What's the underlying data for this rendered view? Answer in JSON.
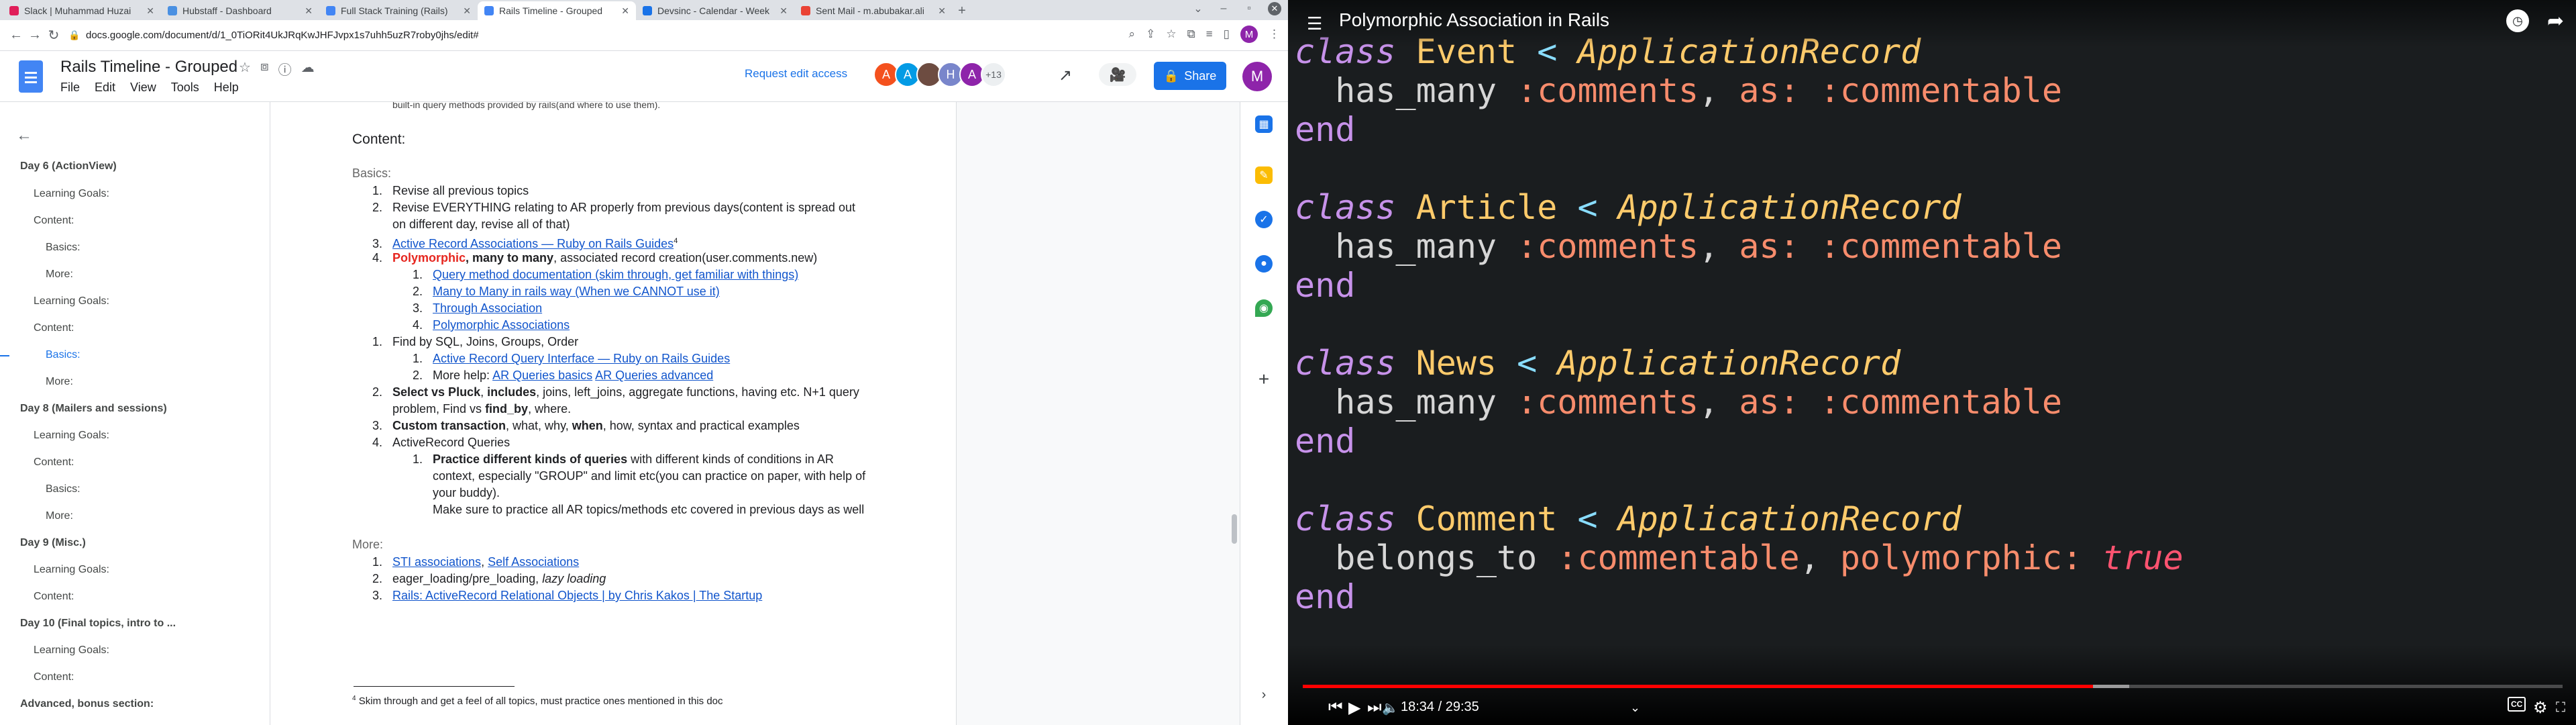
{
  "browser": {
    "tabs": [
      {
        "label": "Slack | Muhammad Huzai",
        "color": "#e01e5a",
        "active": false
      },
      {
        "label": "Hubstaff - Dashboard",
        "color": "#4a90e2",
        "active": false
      },
      {
        "label": "Full Stack Training (Rails)",
        "color": "#4285f4",
        "active": false
      },
      {
        "label": "Rails Timeline - Grouped",
        "color": "#4285f4",
        "active": true
      },
      {
        "label": "Devsinc - Calendar - Week",
        "color": "#1a73e8",
        "active": false
      },
      {
        "label": "Sent Mail - m.abubakar.ali",
        "color": "#ea4335",
        "active": false
      }
    ],
    "new_tab": "+",
    "url": "docs.google.com/document/d/1_0TiORit4UkJRqKwJHFJvpx1s7uhh5uzR7roby0jhs/edit#",
    "profile_initial": "M"
  },
  "docs": {
    "title": "Rails Timeline - Grouped",
    "menus": [
      "File",
      "Edit",
      "View",
      "Tools",
      "Help"
    ],
    "request_access": "Request edit access",
    "collaborators": [
      {
        "initial": "A",
        "color": "#f4511e"
      },
      {
        "initial": "A",
        "color": "#039be5"
      },
      {
        "initial": "",
        "color": "#6d4c41"
      },
      {
        "initial": "H",
        "color": "#7986cb"
      },
      {
        "initial": "A",
        "color": "#8e24aa"
      }
    ],
    "collaborators_more": "+13",
    "share_label": "Share",
    "me_initial": "M"
  },
  "outline": [
    {
      "label": "Day 6 (ActionView)",
      "level": 1
    },
    {
      "label": "Learning Goals:",
      "level": 2
    },
    {
      "label": "Content:",
      "level": 2
    },
    {
      "label": "Basics:",
      "level": 3
    },
    {
      "label": "More:",
      "level": 3
    },
    {
      "label": "Learning Goals:",
      "level": 2
    },
    {
      "label": "Content:",
      "level": 2
    },
    {
      "label": "Basics:",
      "level": 3,
      "selected": true
    },
    {
      "label": "More:",
      "level": 3
    },
    {
      "label": "Day 8 (Mailers and sessions)",
      "level": 1
    },
    {
      "label": "Learning Goals:",
      "level": 2
    },
    {
      "label": "Content:",
      "level": 2
    },
    {
      "label": "Basics:",
      "level": 3
    },
    {
      "label": "More:",
      "level": 3
    },
    {
      "label": "Day 9 (Misc.)",
      "level": 1
    },
    {
      "label": "Learning Goals:",
      "level": 2
    },
    {
      "label": "Content:",
      "level": 2
    },
    {
      "label": "Day 10 (Final topics, intro to ...",
      "level": 1
    },
    {
      "label": "Learning Goals:",
      "level": 2
    },
    {
      "label": "Content:",
      "level": 2
    },
    {
      "label": "Advanced, bonus section:",
      "level": 1
    }
  ],
  "doc": {
    "cut_line": "built-in query methods provided by rails(and where to use them).",
    "content_heading": "Content:",
    "basics_heading": "Basics:",
    "b1": "Revise all previous topics",
    "b2a": "Revise EVERYTHING relating to AR properly from previous days(content is spread out",
    "b2b": "on different day, revise all of that)",
    "b3": "Active Record Associations — Ruby on Rails Guides",
    "b3_sup": "4",
    "b4_red": "Polymorphic",
    "b4_bold": ", many to many",
    "b4_rest": ", associated record creation(user.comments.new)",
    "s1": "Query method documentation (skim through, get familiar with things)",
    "s2": "Many to Many in rails way (When we CANNOT use it)",
    "s3": "Through Association",
    "s4": "Polymorphic Associations",
    "c1": "Find by SQL, Joins, Groups, Order",
    "c1s1": "Active Record Query Interface — Ruby on Rails Guides",
    "c1s2_pre": "More help: ",
    "c1s2_l1": "AR Queries basics",
    "c1s2_l2": "AR Queries advanced",
    "c2_b": "Select vs Pluck",
    "c2_sep": ", ",
    "c2_b2": "includes",
    "c2_rest": ", joins, left_joins, aggregate functions, having etc. N+1 query",
    "c2b_pre": "problem, Find vs ",
    "c2b_b": "find_by",
    "c2b_post": ", where.",
    "c3_b": "Custom transaction",
    "c3_mid": ", what, why, ",
    "c3_b2": "when",
    "c3_rest": ", how, syntax and practical examples",
    "c4": "ActiveRecord Queries",
    "c4s1_b": "Practice different kinds of queries",
    "c4s1_rest": " with different kinds of conditions in AR",
    "c4s1_l2": "context, especially \"GROUP\" and limit etc(you can practice on paper, with help of",
    "c4s1_l3": "your buddy).",
    "c4s1_l4": "Make sure to practice all AR topics/methods etc covered in previous days as well",
    "more_heading": "More:",
    "m1_l1": "STI associations",
    "m1_sep": ", ",
    "m1_l2": "Self Associations",
    "m2_pre": "eager_loading/pre_loading, ",
    "m2_i": "lazy loading",
    "m3": "Rails: ActiveRecord Relational Objects | by Chris Kakos | The Startup",
    "footnote_num": "4",
    "footnote": " Skim through and get a feel of all topics, must practice ones mentioned in this doc",
    "nums": {
      "one": "1.",
      "two": "2.",
      "three": "3.",
      "four": "4."
    }
  },
  "video": {
    "title": "Polymorphic Association in Rails",
    "code": [
      {
        "cls": "Event",
        "parent": "ApplicationRecord",
        "body_kw": "has_many",
        "body_sym": ":comments",
        "opt": "as:",
        "opt_val": ":commentable"
      },
      {
        "cls": "Article",
        "parent": "ApplicationRecord",
        "body_kw": "has_many",
        "body_sym": ":comments",
        "opt": "as:",
        "opt_val": ":commentable"
      },
      {
        "cls": "News",
        "parent": "ApplicationRecord",
        "body_kw": "has_many",
        "body_sym": ":comments",
        "opt": "as:",
        "opt_val": ":commentable"
      },
      {
        "cls": "Comment",
        "parent": "ApplicationRecord",
        "body_kw": "belongs_to",
        "body_sym": ":commentable",
        "opt": "polymorphic:",
        "opt_val": "true"
      }
    ],
    "kw_class": "class",
    "kw_end": "end",
    "lt": "<",
    "time": "18:34 / 29:35",
    "played_fraction": 0.627,
    "buffered_fraction": 0.656,
    "cc_label": "CC"
  }
}
